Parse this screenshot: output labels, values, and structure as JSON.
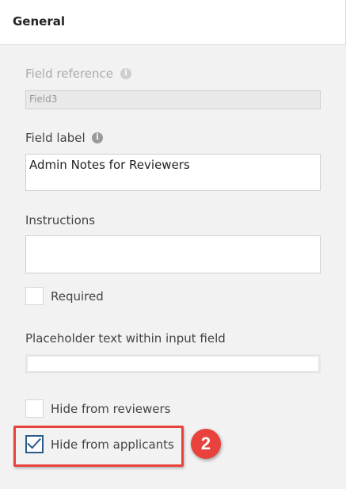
{
  "header": {
    "title": "General"
  },
  "form": {
    "field_reference": {
      "label": "Field reference",
      "value": "Field3"
    },
    "field_label": {
      "label": "Field label",
      "value": "Admin Notes for Reviewers"
    },
    "instructions": {
      "label": "Instructions",
      "value": ""
    },
    "required": {
      "label": "Required",
      "checked": false
    },
    "placeholder": {
      "label": "Placeholder text within input field",
      "value": ""
    },
    "hide_from_reviewers": {
      "label": "Hide from reviewers",
      "checked": false
    },
    "hide_from_applicants": {
      "label": "Hide from applicants",
      "checked": true
    }
  },
  "annotation": {
    "step": "2",
    "color": "#e8423c"
  },
  "icons": {
    "info": "info-icon",
    "check": "checkmark-icon"
  },
  "colors": {
    "accent": "#2a5c88",
    "highlight": "#e8423c",
    "panel_bg": "#f2f2f2"
  }
}
